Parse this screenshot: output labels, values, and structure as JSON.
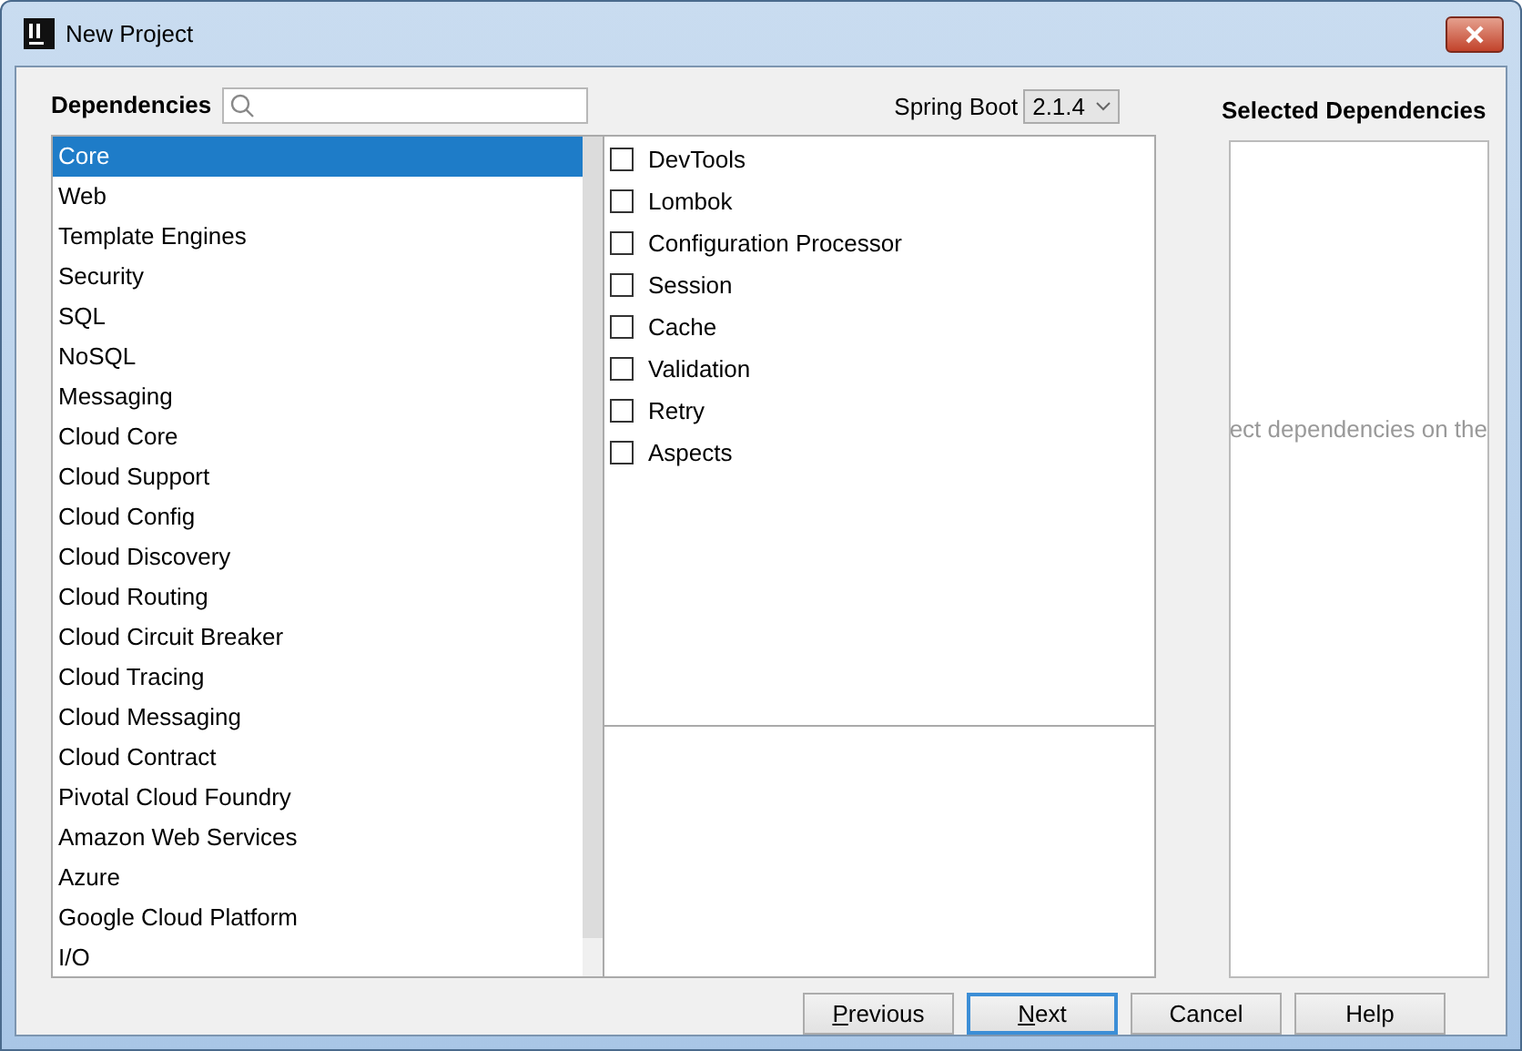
{
  "window": {
    "title": "New Project"
  },
  "dependencies_label": "Dependencies",
  "spring_boot": {
    "label": "Spring Boot",
    "value": "2.1.4"
  },
  "categories": [
    {
      "label": "Core",
      "selected": true
    },
    {
      "label": "Web",
      "selected": false
    },
    {
      "label": "Template Engines",
      "selected": false
    },
    {
      "label": "Security",
      "selected": false
    },
    {
      "label": "SQL",
      "selected": false
    },
    {
      "label": "NoSQL",
      "selected": false
    },
    {
      "label": "Messaging",
      "selected": false
    },
    {
      "label": "Cloud Core",
      "selected": false
    },
    {
      "label": "Cloud Support",
      "selected": false
    },
    {
      "label": "Cloud Config",
      "selected": false
    },
    {
      "label": "Cloud Discovery",
      "selected": false
    },
    {
      "label": "Cloud Routing",
      "selected": false
    },
    {
      "label": "Cloud Circuit Breaker",
      "selected": false
    },
    {
      "label": "Cloud Tracing",
      "selected": false
    },
    {
      "label": "Cloud Messaging",
      "selected": false
    },
    {
      "label": "Cloud Contract",
      "selected": false
    },
    {
      "label": "Pivotal Cloud Foundry",
      "selected": false
    },
    {
      "label": "Amazon Web Services",
      "selected": false
    },
    {
      "label": "Azure",
      "selected": false
    },
    {
      "label": "Google Cloud Platform",
      "selected": false
    },
    {
      "label": "I/O",
      "selected": false
    }
  ],
  "options": [
    {
      "label": "DevTools",
      "checked": false
    },
    {
      "label": "Lombok",
      "checked": false
    },
    {
      "label": "Configuration Processor",
      "checked": false
    },
    {
      "label": "Session",
      "checked": false
    },
    {
      "label": "Cache",
      "checked": false
    },
    {
      "label": "Validation",
      "checked": false
    },
    {
      "label": "Retry",
      "checked": false
    },
    {
      "label": "Aspects",
      "checked": false
    }
  ],
  "selected_panel": {
    "title": "Selected Dependencies",
    "hint": "ect dependencies on the"
  },
  "buttons": [
    {
      "label": "Previous",
      "mnemonic": true,
      "default": false
    },
    {
      "label": "Next",
      "mnemonic": true,
      "default": true
    },
    {
      "label": "Cancel",
      "mnemonic": false,
      "default": false
    },
    {
      "label": "Help",
      "mnemonic": false,
      "default": false
    }
  ]
}
